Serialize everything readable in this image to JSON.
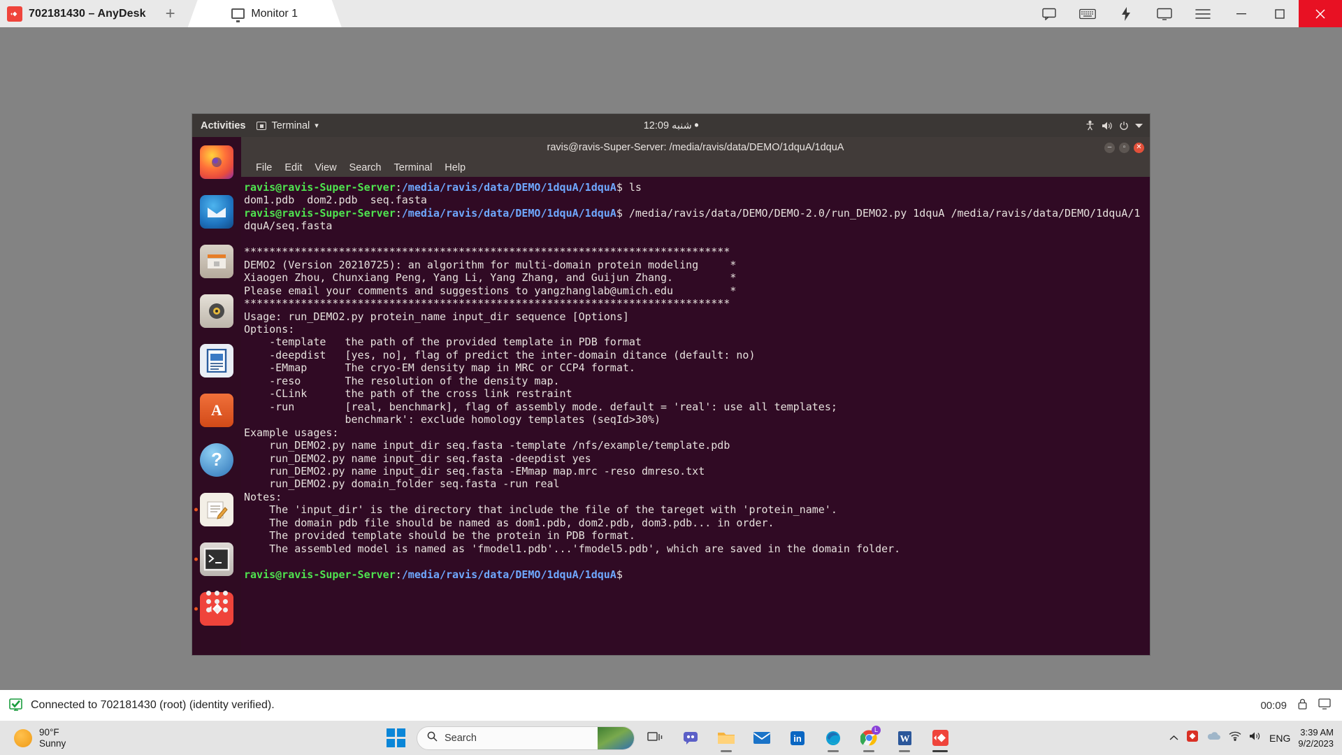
{
  "anydesk": {
    "window_title": "702181430 – AnyDesk",
    "new_tab_label": "+",
    "tab_label": "Monitor 1",
    "titlebar_icons": [
      "chat-icon",
      "keyboard-icon",
      "action-icon",
      "screen-icon",
      "menu-icon"
    ],
    "window_buttons": [
      "minimize",
      "maximize",
      "close"
    ],
    "status_text": "Connected to 702181430 (root) (identity verified).",
    "status_timer": "00:09",
    "status_icons": [
      "lock-icon",
      "monitor-icon"
    ]
  },
  "ubuntu": {
    "topbar": {
      "activities": "Activities",
      "app_menu": "Terminal",
      "app_menu_caret": "▾",
      "clock": "12:09 شنبه",
      "clock_dot": "⏺",
      "sys_icons": [
        "accessibility-icon",
        "volume-icon",
        "power-icon",
        "chevron-down-icon"
      ]
    },
    "launcher": [
      {
        "name": "firefox",
        "glyph": "",
        "bg": "#2b2b2b",
        "running": false
      },
      {
        "name": "thunderbird",
        "glyph": "",
        "bg": "#1b4f8f",
        "running": false
      },
      {
        "name": "files-nautilus",
        "glyph": "",
        "bg": "#c3b9ae",
        "running": false
      },
      {
        "name": "rhythmbox",
        "glyph": "",
        "bg": "#d9d4cc",
        "running": false
      },
      {
        "name": "libreoffice-writer",
        "glyph": "",
        "bg": "#2a5d9e",
        "running": false
      },
      {
        "name": "ubuntu-software",
        "glyph": "A",
        "bg": "#e95420",
        "running": false
      },
      {
        "name": "help",
        "glyph": "?",
        "bg": "#3c7fc1",
        "running": false
      },
      {
        "name": "text-editor",
        "glyph": "",
        "bg": "#efe8dc",
        "running": true
      },
      {
        "name": "terminal",
        "glyph": "$_",
        "bg": "#3b3b3b",
        "running": true
      },
      {
        "name": "anydesk",
        "glyph": "",
        "bg": "#ef443b",
        "running": true
      }
    ]
  },
  "terminal": {
    "title": "ravis@ravis-Super-Server: /media/ravis/data/DEMO/1dquA/1dquA",
    "menu": [
      "File",
      "Edit",
      "View",
      "Search",
      "Terminal",
      "Help"
    ],
    "window_buttons": [
      "minimize",
      "maximize",
      "close"
    ],
    "prompt_user": "ravis@ravis-Super-Server",
    "prompt_path": "/media/ravis/data/DEMO/1dquA/1dquA",
    "prompt_sigil": "$",
    "blocks": [
      {
        "type": "command",
        "command": " ls"
      },
      {
        "type": "output",
        "lines": [
          "dom1.pdb  dom2.pdb  seq.fasta"
        ]
      },
      {
        "type": "command",
        "command": " /media/ravis/data/DEMO/DEMO-2.0/run_DEMO2.py 1dquA /media/ravis/data/DEMO/1dquA/1"
      },
      {
        "type": "output",
        "lines": [
          "dquA/seq.fasta",
          "",
          "*****************************************************************************",
          "DEMO2 (Version 20210725): an algorithm for multi-domain protein modeling     *",
          "Xiaogen Zhou, Chunxiang Peng, Yang Li, Yang Zhang, and Guijun Zhang.         *",
          "Please email your comments and suggestions to yangzhanglab@umich.edu         *",
          "*****************************************************************************",
          "Usage: run_DEMO2.py protein_name input_dir sequence [Options]",
          "Options:",
          "    -template   the path of the provided template in PDB format",
          "    -deepdist   [yes, no], flag of predict the inter-domain ditance (default: no)",
          "    -EMmap      The cryo-EM density map in MRC or CCP4 format.",
          "    -reso       The resolution of the density map.",
          "    -CLink      the path of the cross link restraint",
          "    -run        [real, benchmark], flag of assembly mode. default = 'real': use all templates;",
          "                benchmark': exclude homology templates (seqId>30%)",
          "Example usages:",
          "    run_DEMO2.py name input_dir seq.fasta -template /nfs/example/template.pdb",
          "    run_DEMO2.py name input_dir seq.fasta -deepdist yes",
          "    run_DEMO2.py name input_dir seq.fasta -EMmap map.mrc -reso dmreso.txt",
          "    run_DEMO2.py domain_folder seq.fasta -run real",
          "Notes:",
          "    The 'input_dir' is the directory that include the file of the tareget with 'protein_name'.",
          "    The domain pdb file should be named as dom1.pdb, dom2.pdb, dom3.pdb... in order.",
          "    The provided template should be the protein in PDB format.",
          "    The assembled model is named as 'fmodel1.pdb'...'fmodel5.pdb', which are saved in the domain folder.",
          ""
        ]
      },
      {
        "type": "command",
        "command": ""
      }
    ]
  },
  "taskbar": {
    "weather_temp": "90°F",
    "weather_cond": "Sunny",
    "search_placeholder": "Search",
    "apps": [
      {
        "name": "task-view",
        "glyph": "",
        "color": "#3b3b3b"
      },
      {
        "name": "chat-teams",
        "glyph": "",
        "color": "#5b5fc7"
      },
      {
        "name": "file-explorer",
        "glyph": "",
        "color": "#f3b33d"
      },
      {
        "name": "mail",
        "glyph": "",
        "color": "#1a73c8"
      },
      {
        "name": "linkedin",
        "glyph": "L",
        "color": "#0a66c2"
      },
      {
        "name": "edge",
        "glyph": "",
        "color": "#0f9ed5"
      },
      {
        "name": "chrome",
        "glyph": "",
        "color": "#4285f4",
        "badge": "L"
      },
      {
        "name": "word",
        "glyph": "W",
        "color": "#2b579a"
      },
      {
        "name": "anydesk",
        "glyph": "",
        "color": "#ef443b"
      }
    ],
    "tray_icons": [
      "chevron-up-icon",
      "antivirus-icon",
      "onedrive-icon",
      "network-icon",
      "volume-icon"
    ],
    "language": "ENG",
    "clock_time": "3:39 AM",
    "clock_date": "9/2/2023"
  },
  "colors": {
    "terminal_bg": "#300a24",
    "launcher_bg": "#2f0b22",
    "ubuntu_accent": "#e95420",
    "prompt_green": "#4fe44f",
    "prompt_blue": "#6fa8ff",
    "anydesk_red": "#ef443b",
    "close_red": "#e81123"
  }
}
